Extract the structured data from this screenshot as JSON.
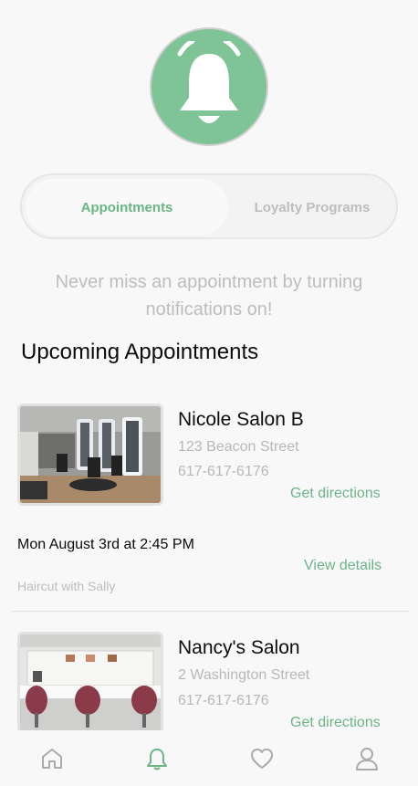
{
  "tabs": {
    "appointments": "Appointments",
    "loyalty": "Loyalty Programs"
  },
  "hint": "Never miss an appointment by turning notifications on!",
  "section_title": "Upcoming Appointments",
  "appointments": [
    {
      "salon": "Nicole Salon B",
      "address": "123 Beacon Street",
      "phone": "617-617-6176",
      "directions": "Get directions",
      "time": "Mon August 3rd at 2:45 PM",
      "service": "Haircut with Sally",
      "details": "View details"
    },
    {
      "salon": "Nancy's Salon",
      "address": "2 Washington Street",
      "phone": "617-617-6176",
      "directions": "Get directions"
    }
  ],
  "colors": {
    "accent": "#6bb585",
    "bell_bg": "#7ec496",
    "muted": "#bdbdbd"
  },
  "nav": {
    "icons": [
      "home-icon",
      "bell-icon",
      "heart-icon",
      "user-icon"
    ],
    "active": "bell-icon"
  }
}
